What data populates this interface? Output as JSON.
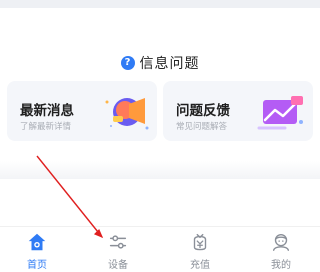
{
  "info_section": {
    "title": "信息问题",
    "help_icon_glyph": "?",
    "cards": [
      {
        "title": "最新消息",
        "subtitle": "了解最新详情",
        "icon": "megaphone-icon"
      },
      {
        "title": "问题反馈",
        "subtitle": "常见问题解答",
        "icon": "chart-card-icon"
      }
    ]
  },
  "tabbar": {
    "items": [
      {
        "label": "首页",
        "icon": "home-icon",
        "active": true
      },
      {
        "label": "设备",
        "icon": "device-sliders-icon",
        "active": false
      },
      {
        "label": "充值",
        "icon": "recharge-icon",
        "active": false
      },
      {
        "label": "我的",
        "icon": "profile-icon",
        "active": false
      }
    ]
  },
  "colors": {
    "accent": "#2f7bf5",
    "annotation_arrow": "#e02020"
  }
}
